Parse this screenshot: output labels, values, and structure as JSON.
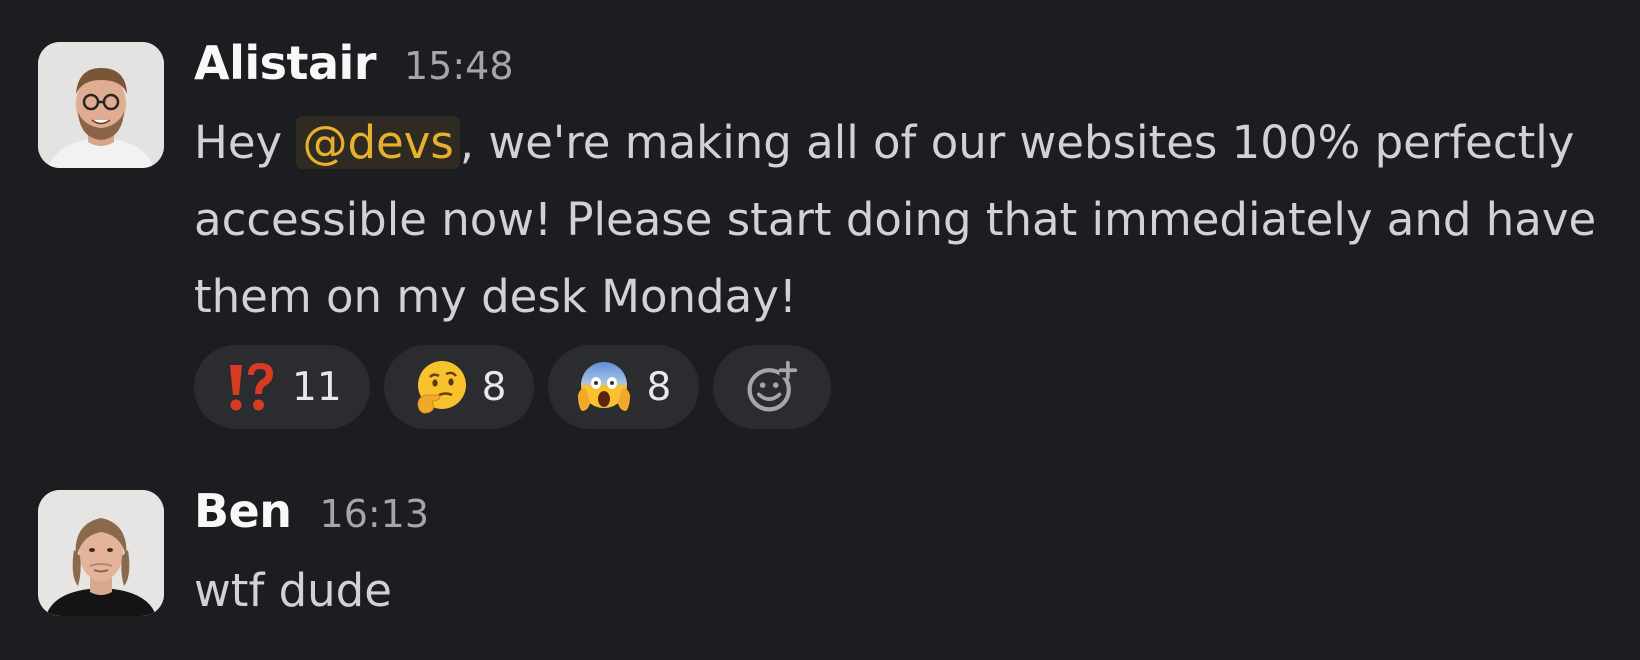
{
  "messages": [
    {
      "author": "Alistair",
      "time": "15:48",
      "text_before": "Hey ",
      "mention": "@devs",
      "text_after": ", we're making all of our websites 100% perfectly accessible now! Please start doing that immediately and have them on my desk Monday!",
      "reactions": [
        {
          "icon": "exclamation-question-mark-emoji",
          "count": "11"
        },
        {
          "icon": "thinking-face-emoji",
          "count": "8"
        },
        {
          "icon": "screaming-face-emoji",
          "count": "8"
        }
      ]
    },
    {
      "author": "Ben",
      "time": "16:13",
      "text": "wtf dude"
    }
  ],
  "colors": {
    "background": "#1c1d21",
    "mention": "#e8b12b",
    "reaction_bg": "#2b2c30"
  }
}
